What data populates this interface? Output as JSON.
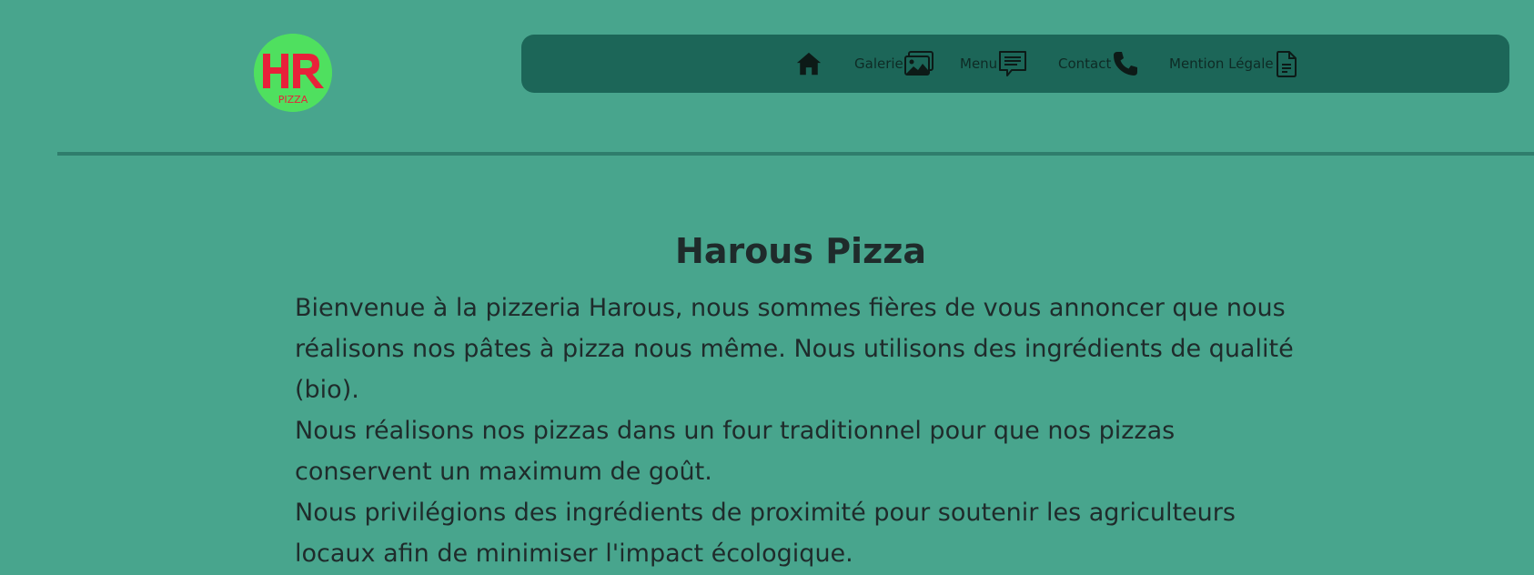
{
  "logo": {
    "letters": "HR",
    "subtitle": "PIZZA",
    "bg_color": "#4fe05f",
    "letter_color": "#e8213a"
  },
  "nav": {
    "items": [
      {
        "label": "",
        "icon": "home-icon"
      },
      {
        "label": "Galerie",
        "icon": "image-icon"
      },
      {
        "label": "Menu",
        "icon": "chat-list-icon"
      },
      {
        "label": "Contact",
        "icon": "phone-icon"
      },
      {
        "label": "Mention Légale",
        "icon": "document-icon"
      }
    ]
  },
  "main": {
    "title": "Harous Pizza",
    "paragraphs": [
      "Bienvenue à la pizzeria Harous, nous sommes fières de vous annoncer que nous réalisons nos pâtes à pizza nous même. Nous utilisons des ingrédients de qualité (bio).",
      "Nous réalisons nos pizzas dans un four traditionnel pour que nos pizzas conservent un maximum de goût.",
      "Nous privilégions des ingrédients de proximité pour soutenir les agriculteurs locaux afin de minimiser l'impact écologique."
    ]
  },
  "colors": {
    "page_bg": "#48a58d",
    "navbar_bg": "#1c6658",
    "divider": "#2f7d6c",
    "text": "#1f2b2b"
  }
}
